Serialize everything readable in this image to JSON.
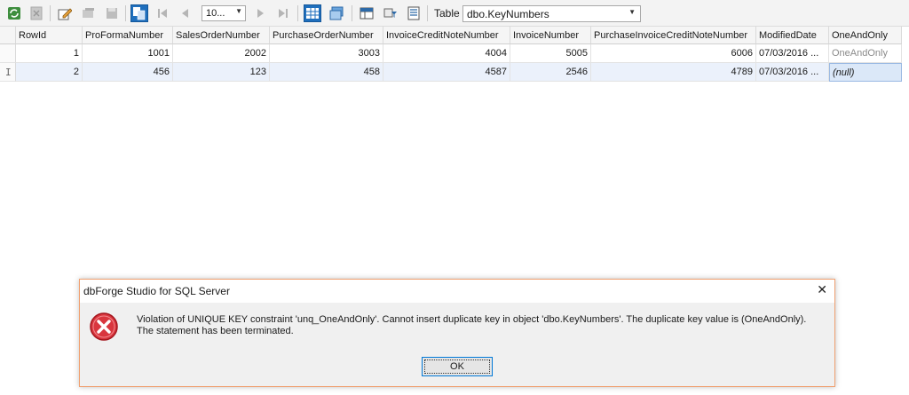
{
  "toolbar": {
    "page_size": "10...",
    "table_label": "Table",
    "table_name": "dbo.KeyNumbers",
    "icons": [
      "refresh-icon",
      "cancel-icon",
      "edit-icon",
      "insert-icon",
      "save-icon",
      "show-all-records-icon",
      "first-page-icon",
      "previous-page-icon",
      "next-page-icon",
      "last-page-icon",
      "grid-view-icon",
      "card-view-icon",
      "data-viewer-icon",
      "filter-icon",
      "print-icon"
    ]
  },
  "grid": {
    "columns": [
      "RowId",
      "ProFormaNumber",
      "SalesOrderNumber",
      "PurchaseOrderNumber",
      "InvoiceCreditNoteNumber",
      "InvoiceNumber",
      "PurchaseInvoiceCreditNoteNumber",
      "ModifiedDate",
      "OneAndOnly"
    ],
    "rows": [
      [
        "1",
        "1001",
        "2002",
        "3003",
        "4004",
        "5005",
        "6006",
        "07/03/2016 ...",
        "OneAndOnly"
      ],
      [
        "2",
        "456",
        "123",
        "458",
        "4587",
        "2546",
        "4789",
        "07/03/2016 ...",
        "(null)"
      ]
    ]
  },
  "dialog": {
    "title": "dbForge Studio for SQL Server",
    "message_line1": "Violation of UNIQUE KEY constraint 'unq_OneAndOnly'. Cannot insert duplicate key in object 'dbo.KeyNumbers'. The duplicate key value is (OneAndOnly).",
    "message_line2": "The statement has been terminated.",
    "ok_label": "OK",
    "close_glyph": "✕"
  },
  "colors": {
    "accent": "#1f6fbd",
    "error": "#d9363e",
    "selection": "#ebf1fb"
  }
}
